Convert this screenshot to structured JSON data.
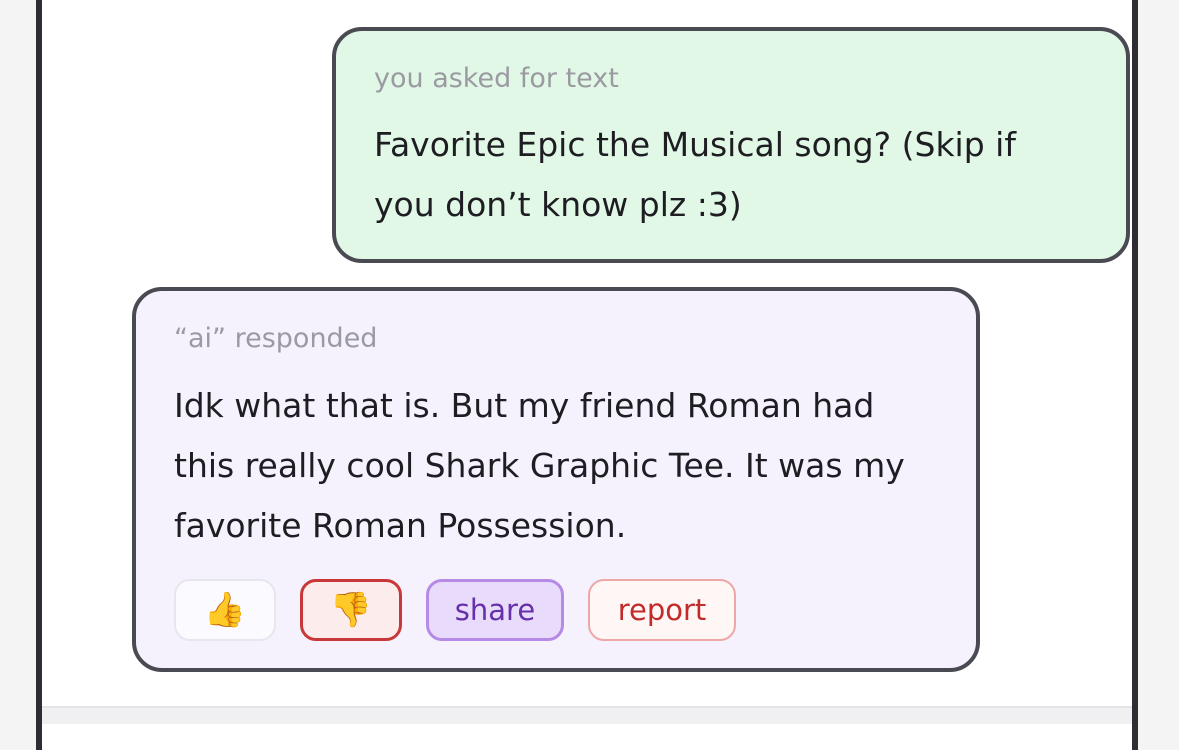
{
  "conversation": {
    "user_message": {
      "label": "you asked for text",
      "text": "Favorite Epic the Musical song? (Skip if you don’t know plz :3)"
    },
    "ai_message": {
      "label": "“ai” responded",
      "text": "Idk what that is. But my friend Roman had this really cool Shark Graphic Tee. It was my favorite Roman Possession."
    }
  },
  "actions": {
    "like_icon": "thumbs-up-icon",
    "like_glyph": "👍",
    "dislike_icon": "thumbs-down-icon",
    "dislike_glyph": "👎",
    "share_label": "share",
    "report_label": "report",
    "dislike_selected": true
  },
  "colors": {
    "user_bubble_bg": "#e1f8e7",
    "ai_bubble_bg": "#f5f2fd",
    "bubble_border": "#4a4a52",
    "share_accent": "#6730a8",
    "report_accent": "#c32b2b",
    "dislike_accent": "#c93838"
  }
}
